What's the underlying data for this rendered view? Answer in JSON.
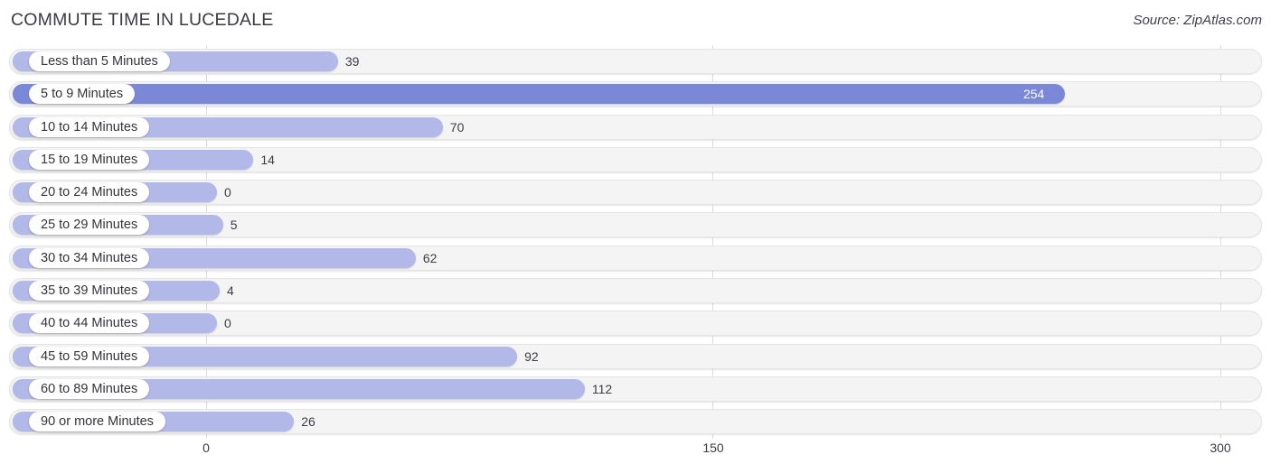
{
  "header": {
    "title": "COMMUTE TIME IN LUCEDALE",
    "source": "Source: ZipAtlas.com"
  },
  "colors": {
    "bar": "#b2b8e8",
    "bar_highlight": "#7b88d8",
    "track": "#f4f4f5",
    "gridline": "#dcdcdc",
    "text": "#3c3c45"
  },
  "chart_data": {
    "type": "bar",
    "orientation": "horizontal",
    "title": "COMMUTE TIME IN LUCEDALE",
    "xlabel": "",
    "ylabel": "",
    "xlim": [
      0,
      300
    ],
    "xticks": [
      0,
      150,
      300
    ],
    "xtick_labels": [
      "0",
      "150",
      "300"
    ],
    "grid": true,
    "legend": false,
    "categories": [
      "Less than 5 Minutes",
      "5 to 9 Minutes",
      "10 to 14 Minutes",
      "15 to 19 Minutes",
      "20 to 24 Minutes",
      "25 to 29 Minutes",
      "30 to 34 Minutes",
      "35 to 39 Minutes",
      "40 to 44 Minutes",
      "45 to 59 Minutes",
      "60 to 89 Minutes",
      "90 or more Minutes"
    ],
    "values": [
      39,
      254,
      70,
      14,
      0,
      5,
      62,
      4,
      0,
      92,
      112,
      26
    ],
    "value_labels": [
      "39",
      "254",
      "70",
      "14",
      "0",
      "5",
      "62",
      "4",
      "0",
      "92",
      "112",
      "26"
    ],
    "highlight_index": 1
  }
}
